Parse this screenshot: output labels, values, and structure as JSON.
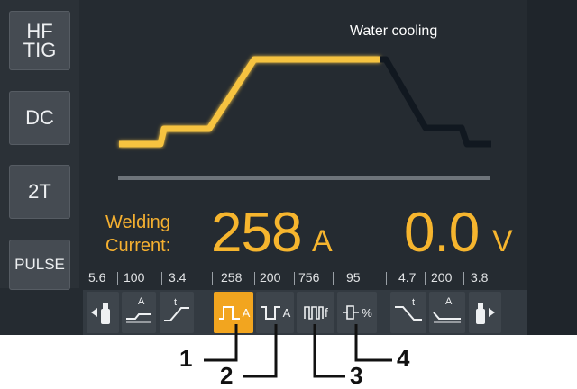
{
  "modes": [
    {
      "id": "hftig",
      "lines": [
        "HF",
        "TIG"
      ]
    },
    {
      "id": "dc",
      "lines": [
        "DC"
      ]
    },
    {
      "id": "2t",
      "lines": [
        "2T"
      ]
    },
    {
      "id": "pulse",
      "lines": [
        "PULSE"
      ]
    }
  ],
  "status_title": "Water cooling",
  "welding_label_line1": "Welding",
  "welding_label_line2": "Current:",
  "current_value": "258",
  "current_unit": "A",
  "voltage_value": "0.0",
  "voltage_unit": "V",
  "parameter_values": [
    "5.6",
    "100",
    "3.4",
    "258",
    "200",
    "756",
    "95",
    "4.7",
    "200",
    "3.8"
  ],
  "toolbar_buttons": [
    {
      "name": "pre-gas-button",
      "icon": "pre-gas-icon",
      "active": false
    },
    {
      "name": "start-current-button",
      "icon": "start-current-icon",
      "label": "A",
      "active": false
    },
    {
      "name": "upslope-button",
      "icon": "upslope-icon",
      "label": "t",
      "active": false
    },
    {
      "name": "peak-current-button",
      "icon": "peak-current-icon",
      "label": "A",
      "active": true
    },
    {
      "name": "base-current-button",
      "icon": "base-current-icon",
      "label": "A",
      "active": false
    },
    {
      "name": "pulse-frequency-button",
      "icon": "pulse-frequency-icon",
      "label": "f",
      "active": false
    },
    {
      "name": "duty-cycle-button",
      "icon": "duty-cycle-icon",
      "label": "%",
      "active": false
    },
    {
      "name": "downslope-button",
      "icon": "downslope-icon",
      "label": "t",
      "active": false
    },
    {
      "name": "crater-current-button",
      "icon": "crater-current-icon",
      "label": "A",
      "active": false
    },
    {
      "name": "post-gas-button",
      "icon": "post-gas-icon",
      "active": false
    }
  ],
  "callouts": [
    "1",
    "2",
    "3",
    "4"
  ],
  "colors": {
    "accent": "#f6b52e",
    "active_button": "#f2a51f",
    "screen_bg": "#252b31"
  }
}
